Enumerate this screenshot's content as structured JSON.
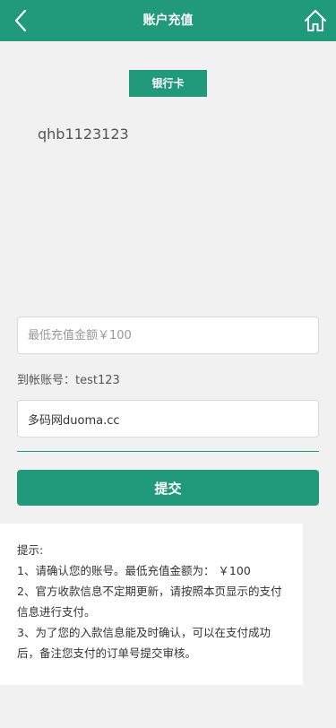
{
  "header": {
    "title": "账户充值",
    "back_icon": "chevron-left-icon",
    "home_icon": "home-icon"
  },
  "payment_method_tab": "银行卡",
  "account_name": "qhb1123123",
  "amount": {
    "placeholder": "最低充值金额￥100",
    "value": ""
  },
  "to_account": "到帐账号：test123",
  "remark": {
    "value": "多码网duoma.cc"
  },
  "submit_label": "提交",
  "tips": {
    "title": "提示:",
    "lines": [
      "1、请确认您的账号。最低充值金额为： ￥100",
      "2、官方收款信息不定期更新，请按照本页显示的支付信息进行支付。",
      "3、为了您的入款信息能及时确认，可以在支付成功后，备注您支付的订单号提交审核。"
    ]
  },
  "colors": {
    "accent": "#219a7b",
    "background": "#f1f1f1"
  }
}
